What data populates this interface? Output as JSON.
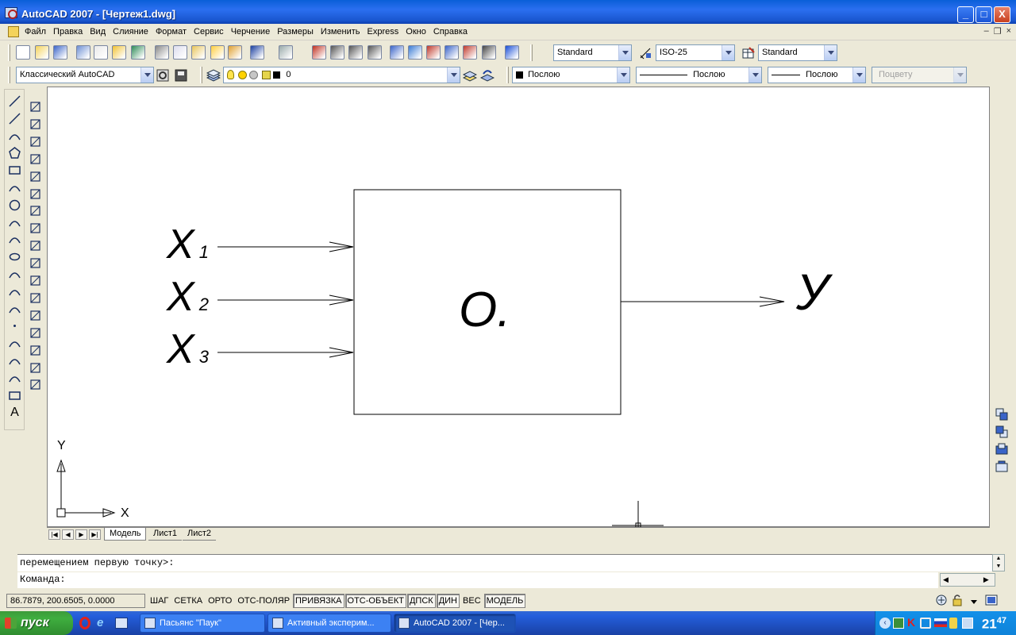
{
  "window": {
    "title": "AutoCAD 2007 - [Чертеж1.dwg]",
    "buttons": {
      "minimize": "_",
      "maximize": "□",
      "close": "X"
    }
  },
  "menu": {
    "items": [
      "Файл",
      "Правка",
      "Вид",
      "Слияние",
      "Формат",
      "Сервис",
      "Черчение",
      "Размеры",
      "Изменить",
      "Express",
      "Окно",
      "Справка"
    ],
    "mdi": {
      "minimize": "–",
      "restore": "❐",
      "close": "×"
    }
  },
  "toolbar1": {
    "text_style": "Standard",
    "dim_style": "ISO-25",
    "table_style": "Standard"
  },
  "toolbar2": {
    "workspace": "Классический AutoCAD",
    "layer": "0",
    "color": "Послою",
    "linetype": "Послою",
    "lineweight": "Послою",
    "plotstyle": "Поцвету"
  },
  "drawing": {
    "inputs": [
      {
        "letter": "X",
        "index": "1"
      },
      {
        "letter": "X",
        "index": "2"
      },
      {
        "letter": "X",
        "index": "3"
      }
    ],
    "block_label": "О.",
    "output": "У",
    "ucs": {
      "x": "X",
      "y": "Y"
    }
  },
  "tabs": {
    "items": [
      "Модель",
      "Лист1",
      "Лист2"
    ],
    "active": "Модель"
  },
  "command": {
    "history": "перемещением первую точку>:",
    "prompt": "Команда:"
  },
  "status": {
    "coords": "86.7879,  200.6505, 0.0000",
    "toggles": [
      {
        "label": "ШАГ",
        "on": false
      },
      {
        "label": "СЕТКА",
        "on": false
      },
      {
        "label": "ОРТО",
        "on": false
      },
      {
        "label": "ОТС-ПОЛЯР",
        "on": false
      },
      {
        "label": "ПРИВЯЗКА",
        "on": true
      },
      {
        "label": "ОТС-ОБЪЕКТ",
        "on": true
      },
      {
        "label": "ДПСК",
        "on": true
      },
      {
        "label": "ДИН",
        "on": true
      },
      {
        "label": "ВЕС",
        "on": false
      },
      {
        "label": "МОДЕЛЬ",
        "on": true
      }
    ]
  },
  "taskbar": {
    "start": "пуск",
    "tasks": [
      {
        "label": "Пасьянс \"Паук\"",
        "active": false
      },
      {
        "label": "Активный эксперим...",
        "active": false
      },
      {
        "label": "AutoCAD 2007 - [Чер...",
        "active": true
      }
    ],
    "clock_hour": "21",
    "clock_min": "47"
  },
  "colors": {
    "accent": "#245edb",
    "canvas": "#ffffff",
    "chrome": "#ece9d8"
  }
}
